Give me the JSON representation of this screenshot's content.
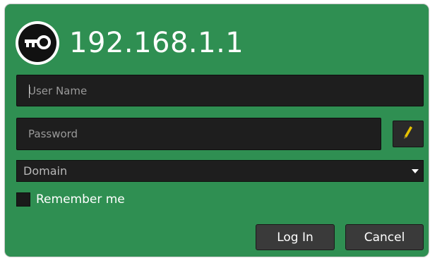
{
  "header": {
    "title": "192.168.1.1",
    "icon": "key-icon"
  },
  "form": {
    "username": {
      "placeholder": "User Name",
      "value": ""
    },
    "password": {
      "placeholder": "Password",
      "value": "",
      "edit_icon": "pencil-icon"
    },
    "domain": {
      "selected": "Domain",
      "arrow_icon": "chevron-down-icon"
    },
    "remember": {
      "label": "Remember me",
      "checked": false
    }
  },
  "buttons": {
    "login_label": "Log In",
    "cancel_label": "Cancel"
  },
  "colors": {
    "background": "#2f8f52",
    "field": "#1e1e1e",
    "button": "#3a3a3a",
    "pencil": "#e6c200"
  }
}
